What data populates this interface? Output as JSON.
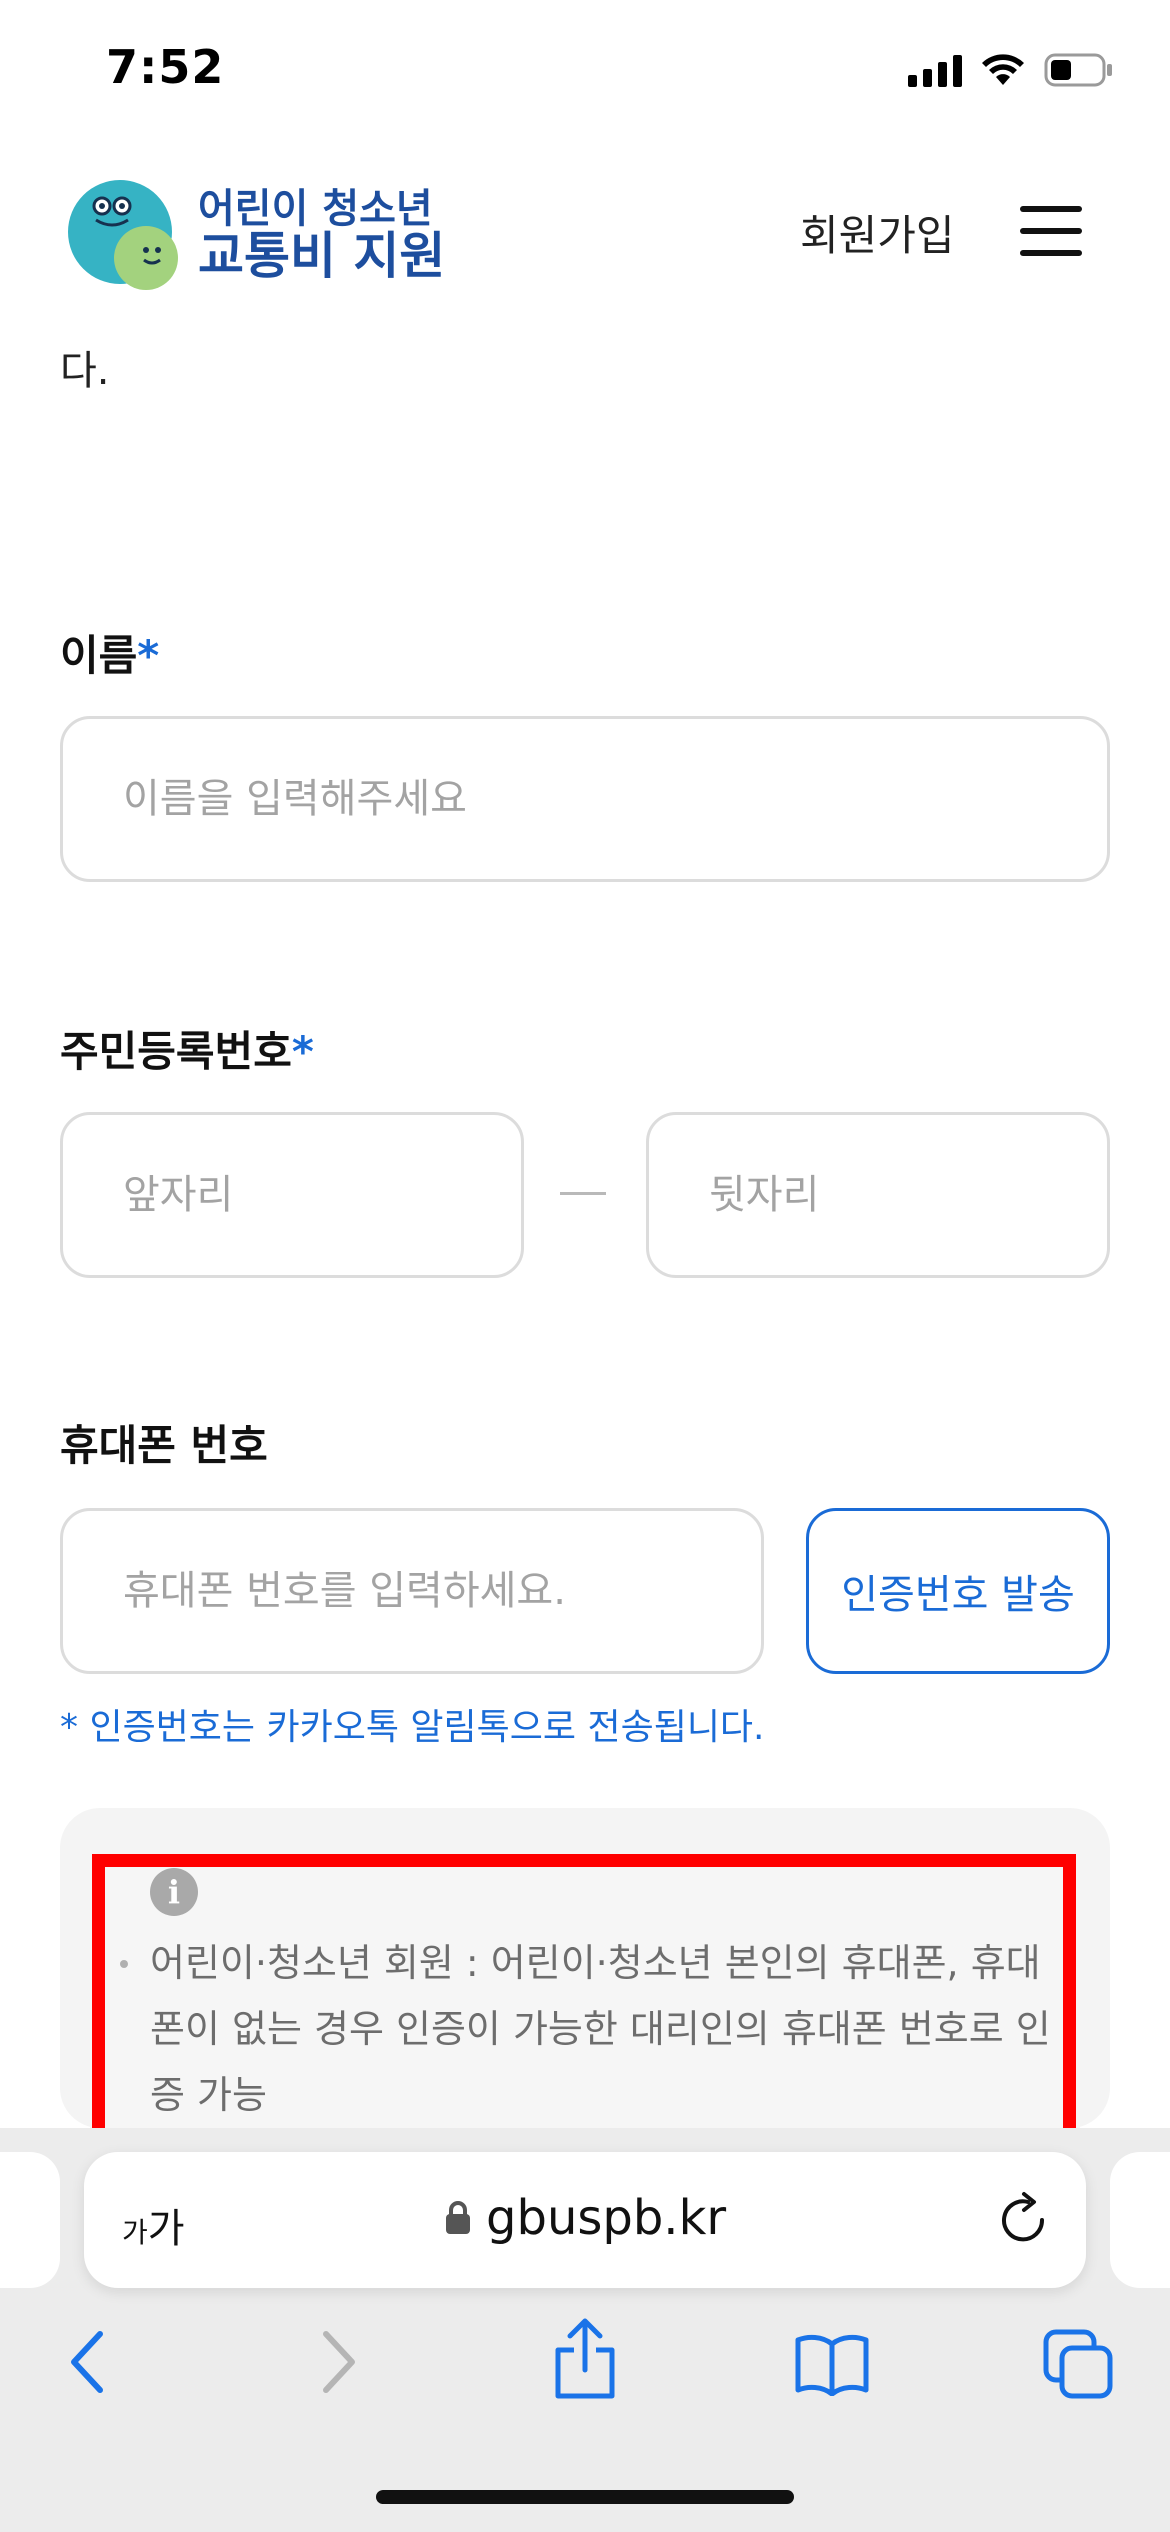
{
  "status_bar": {
    "time": "7:52"
  },
  "header": {
    "logo_line1": "어린이 청소년",
    "logo_line2": "교통비 지원",
    "signup_label": "회원가입"
  },
  "previous_text_end": "다.",
  "form": {
    "name": {
      "label": "이름",
      "required_mark": "*",
      "placeholder": "이름을 입력해주세요"
    },
    "rrn": {
      "label": "주민등록번호",
      "required_mark": "*",
      "front_placeholder": "앞자리",
      "back_placeholder": "뒷자리"
    },
    "phone": {
      "label": "휴대폰 번호",
      "placeholder": "휴대폰 번호를 입력하세요.",
      "send_button": "인증번호 발송",
      "note": "* 인증번호는 카카오톡 알림톡으로 전송됩니다."
    }
  },
  "info": {
    "icon_glyph": "i",
    "text": "어린이·청소년 회원 : 어린이·청소년 본인의 휴대폰, 휴대폰이 없는 경우 인증이 가능한 대리인의 휴대폰 번호로 인증 가능"
  },
  "browser": {
    "text_size_small": "가",
    "text_size_large": "가",
    "url": "gbuspb.kr"
  },
  "colors": {
    "accent_blue": "#1a6bd6",
    "logo_blue": "#1d4e9e",
    "highlight_red": "#ff0000"
  }
}
